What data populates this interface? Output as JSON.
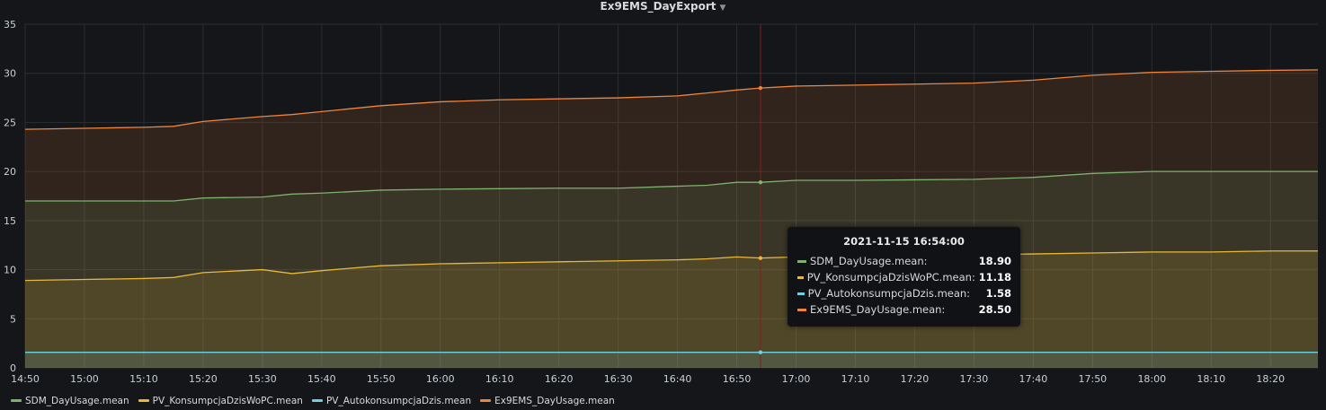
{
  "panel": {
    "title": "Ex9EMS_DayExport"
  },
  "tooltip": {
    "time": "2021-11-15 16:54:00",
    "rows": [
      {
        "name": "SDM_DayUsage.mean:",
        "value": "18.90",
        "color": "#7eb26d"
      },
      {
        "name": "PV_KonsumpcjaDzisWoPC.mean:",
        "value": "11.18",
        "color": "#eab839"
      },
      {
        "name": "PV_AutokonsumpcjaDzis.mean:",
        "value": "1.58",
        "color": "#6ed0e0"
      },
      {
        "name": "Ex9EMS_DayUsage.mean:",
        "value": "28.50",
        "color": "#ef843c"
      }
    ]
  },
  "chart_data": {
    "type": "area",
    "xlabel": "",
    "ylabel": "",
    "x_ticks": [
      "14:50",
      "15:00",
      "15:10",
      "15:20",
      "15:30",
      "15:40",
      "15:50",
      "16:00",
      "16:10",
      "16:20",
      "16:30",
      "16:40",
      "16:50",
      "17:00",
      "17:10",
      "17:20",
      "17:30",
      "17:40",
      "17:50",
      "18:00",
      "18:10",
      "18:20"
    ],
    "xlim": [
      "14:50",
      "18:28"
    ],
    "ylim": [
      0,
      35
    ],
    "y_ticks": [
      0,
      5,
      10,
      15,
      20,
      25,
      30,
      35
    ],
    "grid": true,
    "legend_position": "bottom-left",
    "crosshair_x": "16:54",
    "x": [
      "14:50",
      "15:00",
      "15:10",
      "15:15",
      "15:20",
      "15:30",
      "15:35",
      "15:40",
      "15:50",
      "16:00",
      "16:10",
      "16:20",
      "16:30",
      "16:40",
      "16:45",
      "16:50",
      "16:54",
      "17:00",
      "17:10",
      "17:20",
      "17:30",
      "17:40",
      "17:50",
      "18:00",
      "18:10",
      "18:20",
      "18:28"
    ],
    "series": [
      {
        "name": "SDM_DayUsage.mean",
        "color": "#7eb26d",
        "values": [
          17.0,
          17.0,
          17.0,
          17.0,
          17.3,
          17.4,
          17.7,
          17.8,
          18.1,
          18.2,
          18.25,
          18.3,
          18.3,
          18.5,
          18.6,
          18.9,
          18.9,
          19.1,
          19.1,
          19.15,
          19.2,
          19.4,
          19.8,
          20.0,
          20.0,
          20.0,
          20.0
        ]
      },
      {
        "name": "PV_KonsumpcjaDzisWoPC.mean",
        "color": "#eab839",
        "values": [
          8.9,
          9.0,
          9.1,
          9.2,
          9.7,
          10.0,
          9.6,
          9.9,
          10.4,
          10.6,
          10.7,
          10.8,
          10.9,
          11.0,
          11.1,
          11.3,
          11.18,
          11.3,
          11.4,
          11.5,
          11.5,
          11.6,
          11.7,
          11.8,
          11.8,
          11.9,
          11.9
        ]
      },
      {
        "name": "PV_AutokonsumpcjaDzis.mean",
        "color": "#6ed0e0",
        "values": [
          1.58,
          1.58,
          1.58,
          1.58,
          1.58,
          1.58,
          1.58,
          1.58,
          1.58,
          1.58,
          1.58,
          1.58,
          1.58,
          1.58,
          1.58,
          1.58,
          1.58,
          1.58,
          1.58,
          1.58,
          1.58,
          1.58,
          1.58,
          1.58,
          1.58,
          1.58,
          1.58
        ]
      },
      {
        "name": "Ex9EMS_DayUsage.mean",
        "color": "#ef843c",
        "values": [
          24.3,
          24.4,
          24.5,
          24.6,
          25.1,
          25.6,
          25.8,
          26.1,
          26.7,
          27.1,
          27.3,
          27.4,
          27.5,
          27.7,
          28.0,
          28.3,
          28.5,
          28.7,
          28.8,
          28.9,
          29.0,
          29.3,
          29.8,
          30.1,
          30.2,
          30.3,
          30.35
        ]
      }
    ]
  }
}
